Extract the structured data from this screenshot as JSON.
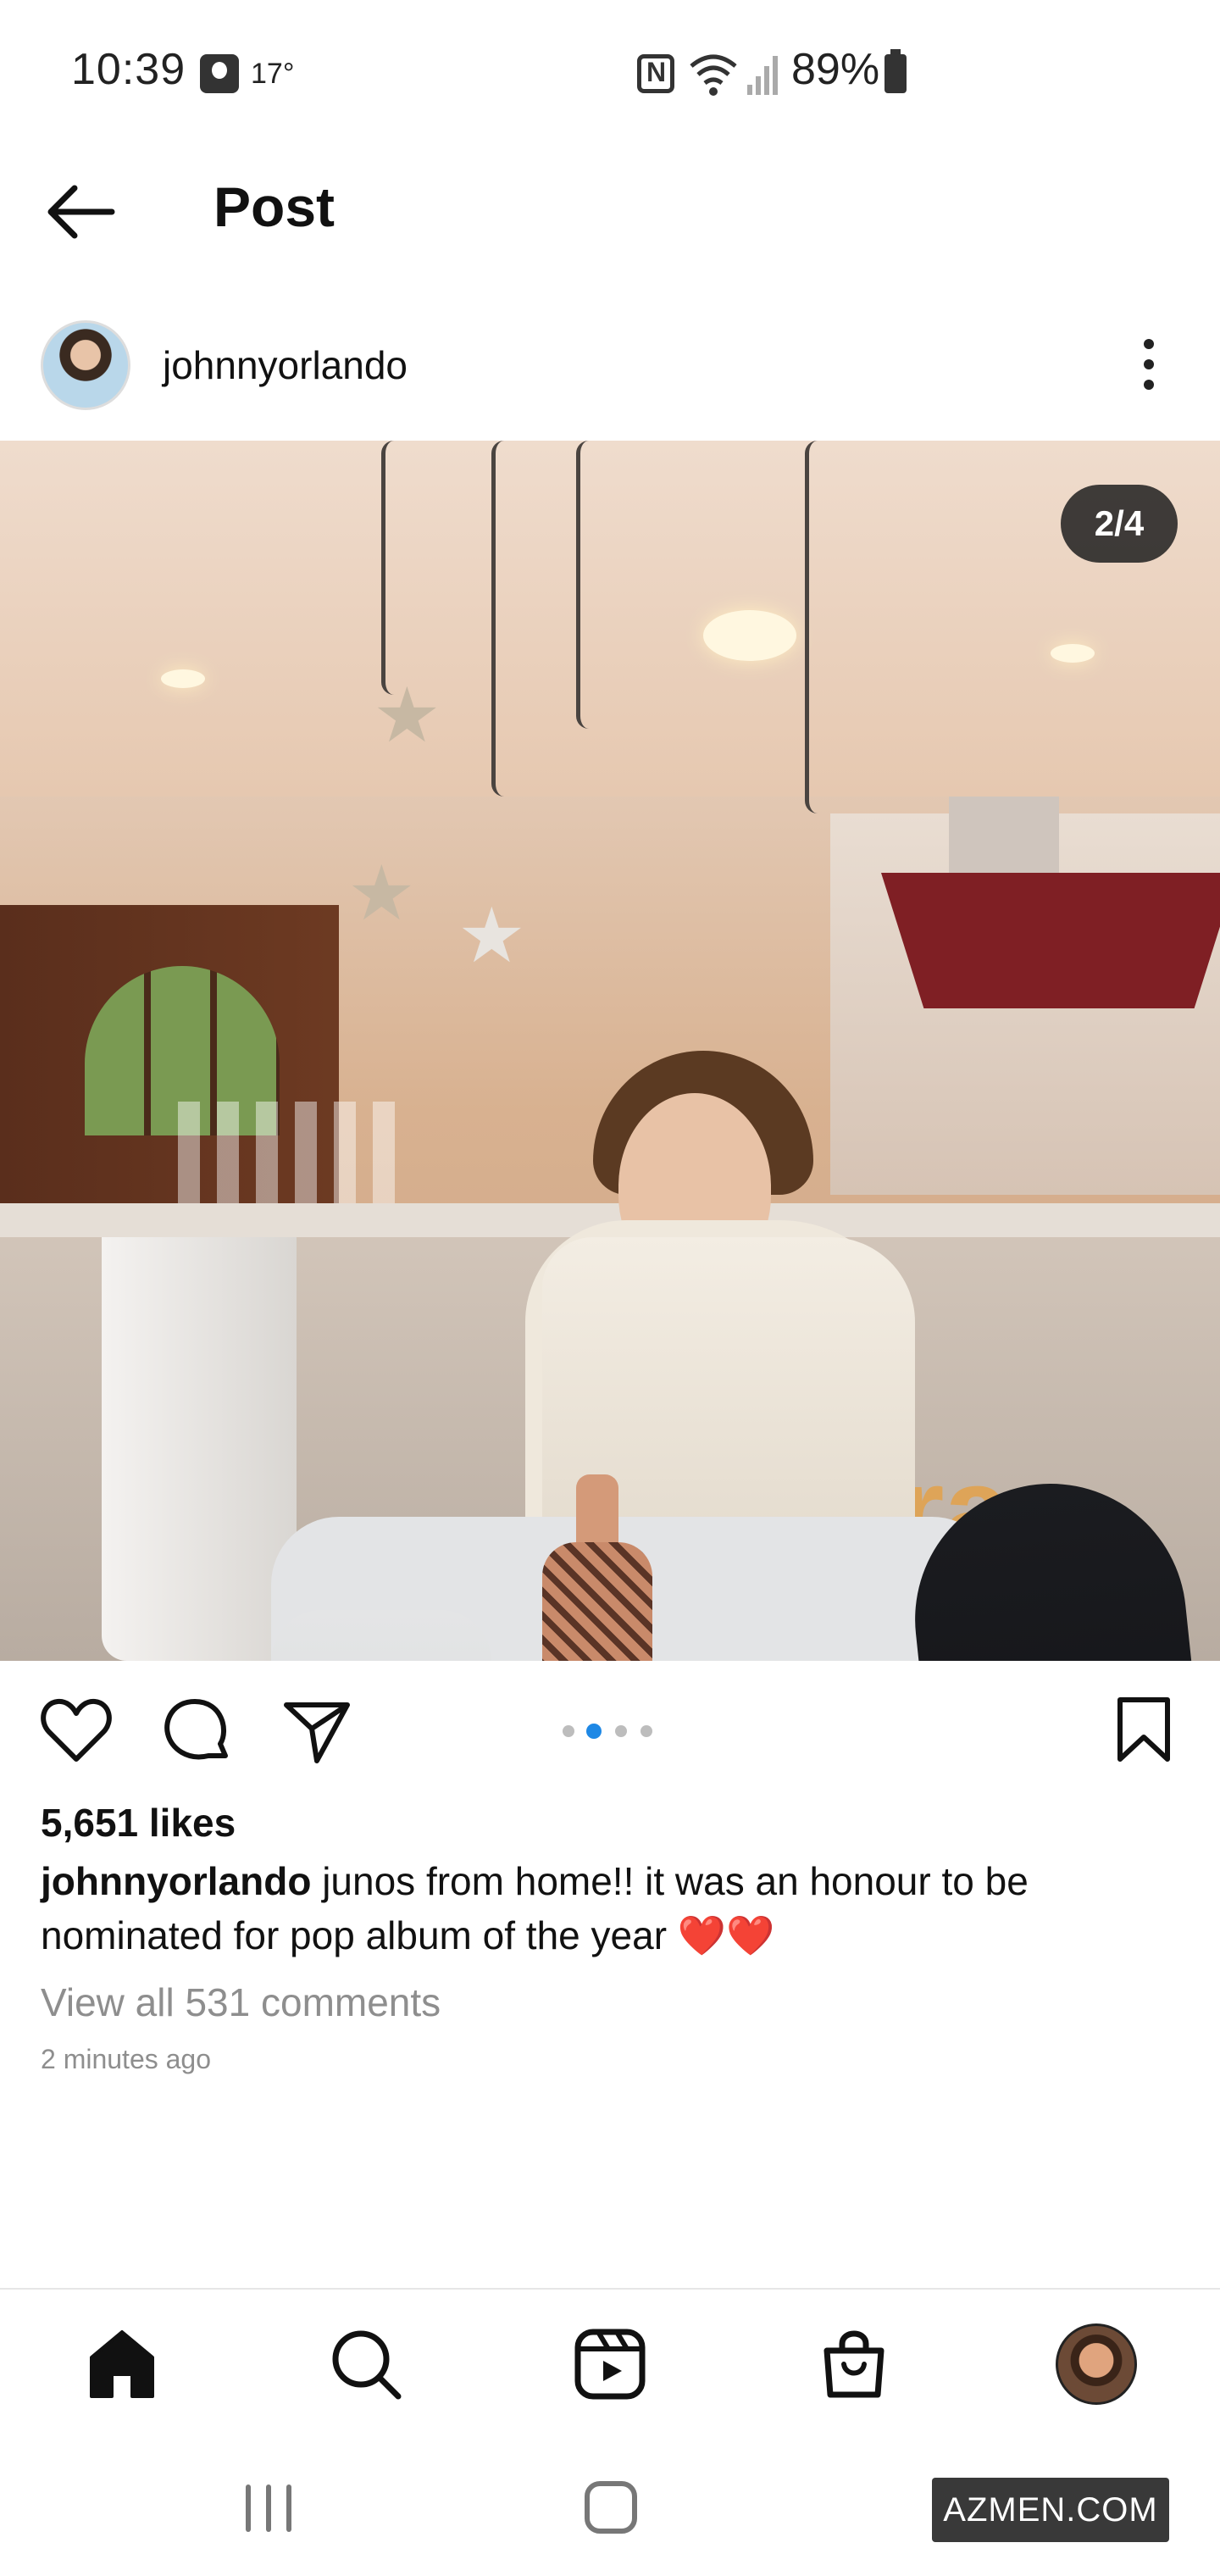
{
  "status_bar": {
    "time": "10:39",
    "temperature": "17°",
    "battery": "89%"
  },
  "header": {
    "title": "Post"
  },
  "post": {
    "username": "johnnyorlando",
    "image_counter": "2/4",
    "carousel": {
      "total": 4,
      "active_index": 1
    },
    "likes": "5,651 likes",
    "caption_user": "johnnyorlando",
    "caption_text": "junos from home!! it was an honour to be nominated for pop album of the year",
    "caption_emoji": "❤️❤️",
    "view_comments": "View all 531 comments",
    "timestamp": "2 minutes ago"
  },
  "photo": {
    "sign_text": "ra"
  },
  "icons": {
    "back": "arrow-left-icon",
    "more": "more-vertical-icon",
    "like": "heart-icon",
    "comment": "comment-icon",
    "share": "send-icon",
    "save": "bookmark-icon"
  },
  "tab_bar": [
    {
      "name": "home",
      "icon": "home-icon",
      "active": true
    },
    {
      "name": "search",
      "icon": "search-icon",
      "active": false
    },
    {
      "name": "reels",
      "icon": "reels-icon",
      "active": false
    },
    {
      "name": "shop",
      "icon": "shop-icon",
      "active": false
    },
    {
      "name": "profile",
      "icon": "profile-avatar",
      "active": false
    }
  ],
  "watermark": "AZMEN.COM",
  "colors": {
    "accent_dot": "#1e88e5",
    "heart_emoji": "#e0242d"
  }
}
